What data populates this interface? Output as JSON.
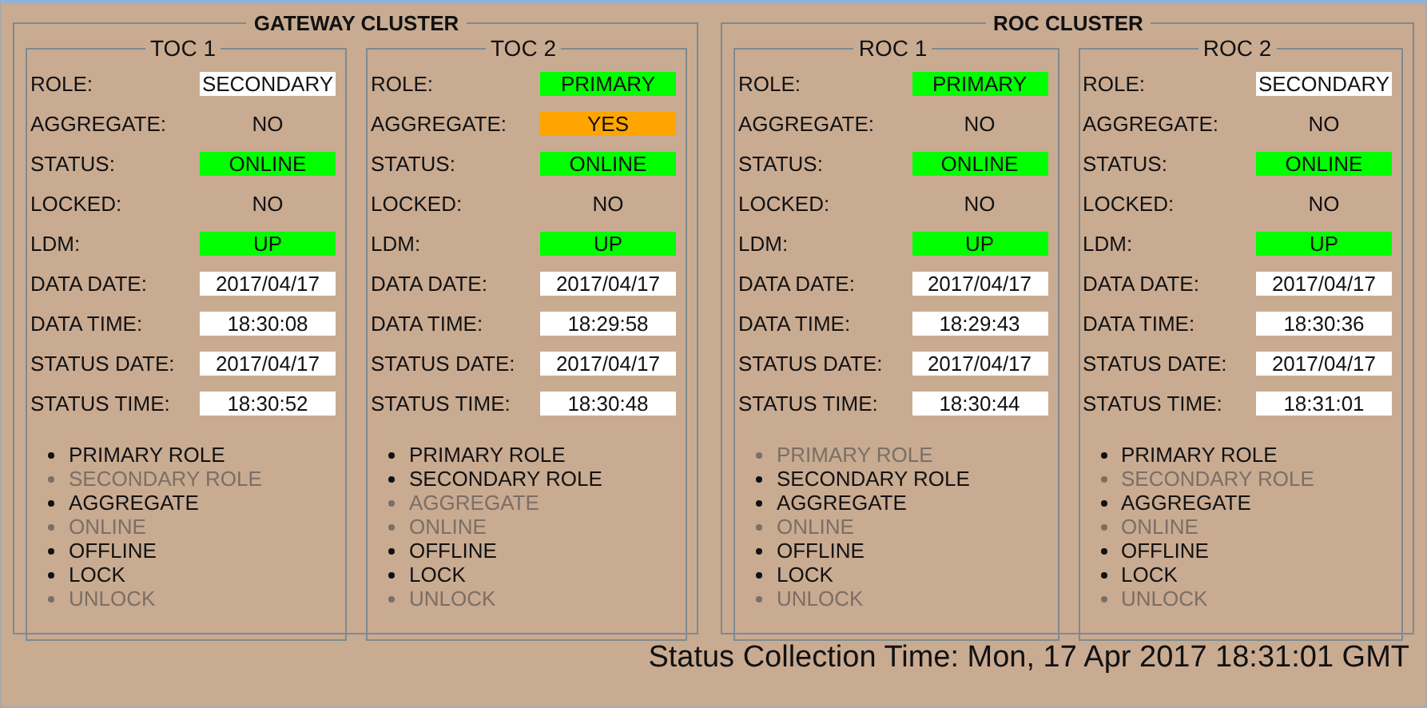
{
  "clusters": [
    {
      "title": "GATEWAY CLUSTER",
      "nodes": [
        {
          "title": "TOC 1",
          "fields": [
            {
              "label": "ROLE:",
              "value": "SECONDARY",
              "color": "#ffffff"
            },
            {
              "label": "AGGREGATE:",
              "value": "NO"
            },
            {
              "label": "STATUS:",
              "value": "ONLINE",
              "color": "#00ff00"
            },
            {
              "label": "LOCKED:",
              "value": "NO"
            },
            {
              "label": "LDM:",
              "value": "UP",
              "color": "#00ff00"
            },
            {
              "label": "DATA DATE:",
              "value": "2017/04/17",
              "color": "#ffffff"
            },
            {
              "label": "DATA TIME:",
              "value": "18:30:08",
              "color": "#ffffff"
            },
            {
              "label": "STATUS DATE:",
              "value": "2017/04/17",
              "color": "#ffffff"
            },
            {
              "label": "STATUS TIME:",
              "value": "18:30:52",
              "color": "#ffffff"
            }
          ],
          "actions": [
            {
              "label": "PRIMARY ROLE",
              "disabled": false
            },
            {
              "label": "SECONDARY ROLE",
              "disabled": true
            },
            {
              "label": "AGGREGATE",
              "disabled": false
            },
            {
              "label": "ONLINE",
              "disabled": true
            },
            {
              "label": "OFFLINE",
              "disabled": false
            },
            {
              "label": "LOCK",
              "disabled": false
            },
            {
              "label": "UNLOCK",
              "disabled": true
            }
          ]
        },
        {
          "title": "TOC 2",
          "fields": [
            {
              "label": "ROLE:",
              "value": "PRIMARY",
              "color": "#00ff00"
            },
            {
              "label": "AGGREGATE:",
              "value": "YES",
              "color": "#ffa500"
            },
            {
              "label": "STATUS:",
              "value": "ONLINE",
              "color": "#00ff00"
            },
            {
              "label": "LOCKED:",
              "value": "NO"
            },
            {
              "label": "LDM:",
              "value": "UP",
              "color": "#00ff00"
            },
            {
              "label": "DATA DATE:",
              "value": "2017/04/17",
              "color": "#ffffff"
            },
            {
              "label": "DATA TIME:",
              "value": "18:29:58",
              "color": "#ffffff"
            },
            {
              "label": "STATUS DATE:",
              "value": "2017/04/17",
              "color": "#ffffff"
            },
            {
              "label": "STATUS TIME:",
              "value": "18:30:48",
              "color": "#ffffff"
            }
          ],
          "actions": [
            {
              "label": "PRIMARY ROLE",
              "disabled": false
            },
            {
              "label": "SECONDARY ROLE",
              "disabled": false
            },
            {
              "label": "AGGREGATE",
              "disabled": true
            },
            {
              "label": "ONLINE",
              "disabled": true
            },
            {
              "label": "OFFLINE",
              "disabled": false
            },
            {
              "label": "LOCK",
              "disabled": false
            },
            {
              "label": "UNLOCK",
              "disabled": true
            }
          ]
        }
      ]
    },
    {
      "title": "ROC CLUSTER",
      "nodes": [
        {
          "title": "ROC 1",
          "fields": [
            {
              "label": "ROLE:",
              "value": "PRIMARY",
              "color": "#00ff00"
            },
            {
              "label": "AGGREGATE:",
              "value": "NO"
            },
            {
              "label": "STATUS:",
              "value": "ONLINE",
              "color": "#00ff00"
            },
            {
              "label": "LOCKED:",
              "value": "NO"
            },
            {
              "label": "LDM:",
              "value": "UP",
              "color": "#00ff00"
            },
            {
              "label": "DATA DATE:",
              "value": "2017/04/17",
              "color": "#ffffff"
            },
            {
              "label": "DATA TIME:",
              "value": "18:29:43",
              "color": "#ffffff"
            },
            {
              "label": "STATUS DATE:",
              "value": "2017/04/17",
              "color": "#ffffff"
            },
            {
              "label": "STATUS TIME:",
              "value": "18:30:44",
              "color": "#ffffff"
            }
          ],
          "actions": [
            {
              "label": "PRIMARY ROLE",
              "disabled": true
            },
            {
              "label": "SECONDARY ROLE",
              "disabled": false
            },
            {
              "label": "AGGREGATE",
              "disabled": false
            },
            {
              "label": "ONLINE",
              "disabled": true
            },
            {
              "label": "OFFLINE",
              "disabled": false
            },
            {
              "label": "LOCK",
              "disabled": false
            },
            {
              "label": "UNLOCK",
              "disabled": true
            }
          ]
        },
        {
          "title": "ROC 2",
          "fields": [
            {
              "label": "ROLE:",
              "value": "SECONDARY",
              "color": "#ffffff"
            },
            {
              "label": "AGGREGATE:",
              "value": "NO"
            },
            {
              "label": "STATUS:",
              "value": "ONLINE",
              "color": "#00ff00"
            },
            {
              "label": "LOCKED:",
              "value": "NO"
            },
            {
              "label": "LDM:",
              "value": "UP",
              "color": "#00ff00"
            },
            {
              "label": "DATA DATE:",
              "value": "2017/04/17",
              "color": "#ffffff"
            },
            {
              "label": "DATA TIME:",
              "value": "18:30:36",
              "color": "#ffffff"
            },
            {
              "label": "STATUS DATE:",
              "value": "2017/04/17",
              "color": "#ffffff"
            },
            {
              "label": "STATUS TIME:",
              "value": "18:31:01",
              "color": "#ffffff"
            }
          ],
          "actions": [
            {
              "label": "PRIMARY ROLE",
              "disabled": false
            },
            {
              "label": "SECONDARY ROLE",
              "disabled": true
            },
            {
              "label": "AGGREGATE",
              "disabled": false
            },
            {
              "label": "ONLINE",
              "disabled": true
            },
            {
              "label": "OFFLINE",
              "disabled": false
            },
            {
              "label": "LOCK",
              "disabled": false
            },
            {
              "label": "UNLOCK",
              "disabled": true
            }
          ]
        }
      ]
    }
  ],
  "status_collection": "Status Collection Time: Mon, 17 Apr 2017 18:31:01 GMT"
}
